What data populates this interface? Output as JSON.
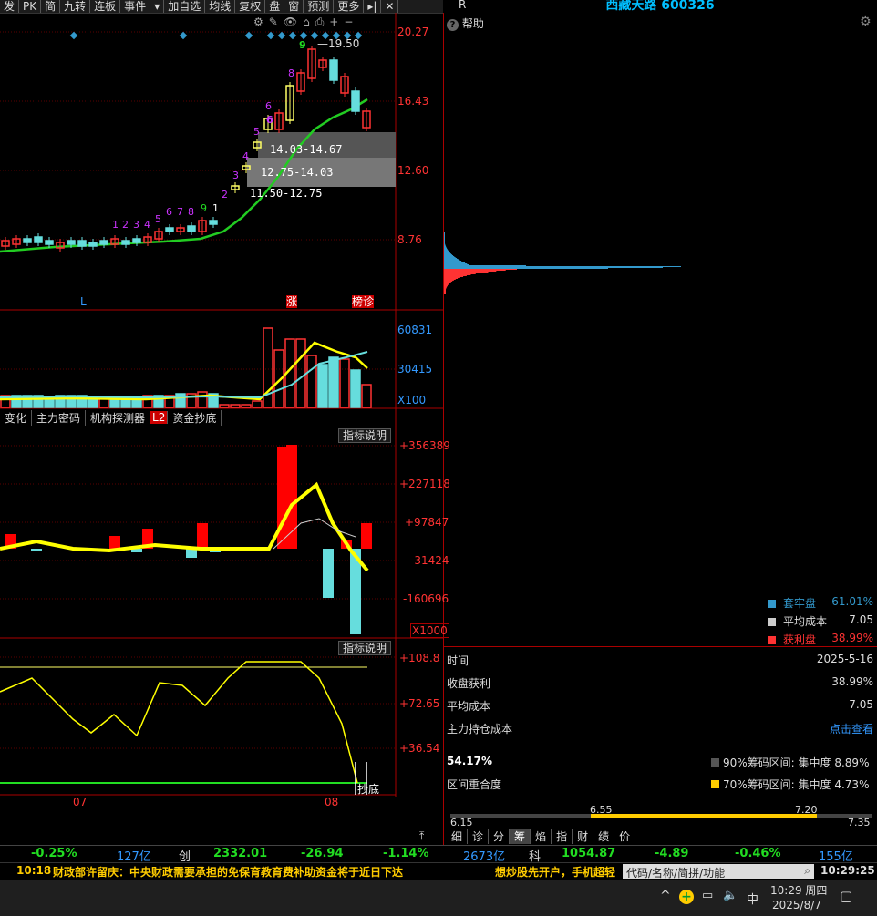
{
  "toolbar": {
    "items": [
      "发",
      "PK",
      "简",
      "九转",
      "连板",
      "事件",
      "▾",
      "加自选",
      "均线",
      "复权",
      "盘",
      "窗",
      "预测",
      "更多",
      "▸|",
      "✕"
    ]
  },
  "stock": {
    "title": "西藏天路 600326",
    "r_mark": "R"
  },
  "help": {
    "label": "帮助",
    "icon": "?"
  },
  "kline": {
    "price_axis": [
      "20.27",
      "16.43",
      "12.60",
      "8.76"
    ],
    "high_label": "19.50",
    "zones": [
      "14.03-14.67",
      "12.75-14.03",
      "11.50-12.75"
    ],
    "seq_top": [
      "1",
      "2",
      "3",
      "4",
      "5",
      "6",
      "7",
      "8",
      "9"
    ],
    "seq_mid": [
      "1",
      "2",
      "3",
      "4",
      "5",
      "6",
      "7",
      "8",
      "9",
      "1",
      "2",
      "3",
      "4",
      "5",
      "6",
      "8"
    ],
    "markers": {
      "l": "L",
      "zhang": "涨",
      "bangzhen": "榜诊"
    },
    "tool_icons": [
      "⚙",
      "✎",
      "👁",
      "⌂",
      "⎙",
      "+",
      "−"
    ]
  },
  "volume": {
    "axis": [
      "60831",
      "30415",
      "X100"
    ]
  },
  "tabs": {
    "items": [
      "变化",
      "主力密码",
      "机构探测器",
      "L2",
      "资金抄底"
    ]
  },
  "ind1": {
    "btn": "指标说明",
    "axis": [
      "+356389",
      "+227118",
      "+97847",
      "-31424",
      "-160696",
      "X1000"
    ]
  },
  "ind2": {
    "btn": "指标说明",
    "axis": [
      "+108.8",
      "+72.65",
      "+36.54"
    ],
    "bottom_label": "抄底"
  },
  "xaxis": {
    "labels": [
      "07",
      "08"
    ]
  },
  "chip": {
    "legend": [
      {
        "name": "套牢盘",
        "value": "61.01%",
        "color": "#3399cc"
      },
      {
        "name": "平均成本",
        "value": "7.05",
        "color": "#cccccc"
      },
      {
        "name": "获利盘",
        "value": "38.99%",
        "color": "#ff3333"
      }
    ],
    "rows": [
      {
        "label": "时间",
        "value": "2025-5-16"
      },
      {
        "label": "收盘获利",
        "value": "38.99%"
      },
      {
        "label": "平均成本",
        "value": "7.05"
      },
      {
        "label": "主力持仓成本",
        "value": "点击查看"
      }
    ],
    "overlap_pct": "54.17%",
    "overlap_label": "区间重合度",
    "range90": "90%筹码区间: 集中度 8.89%",
    "range70": "70%筹码区间: 集中度 4.73%",
    "scale": [
      "6.15",
      "6.55",
      "7.20",
      "7.35"
    ],
    "bottom_tabs": [
      "细",
      "诊",
      "分",
      "筹",
      "焰",
      "指",
      "财",
      "绩",
      "价"
    ],
    "active_tab": "筹"
  },
  "indexbar": {
    "items": [
      "-0.25%",
      "127亿",
      "创",
      "2332.01",
      "-26.94",
      "-1.14%",
      "2673亿",
      "科",
      "1054.87",
      "-4.89",
      "-0.46%",
      "155亿"
    ]
  },
  "news": {
    "time": "10:18",
    "text": "财政部许留庆：中央财政需要承担的免保育教育费补助资金将于近日下达",
    "ad": "想炒股先开户，手机超轻",
    "search_placeholder": "代码/名称/简拼/功能",
    "clock": "10:29:25"
  },
  "taskbar": {
    "ime": "中",
    "time": "10:29 周四",
    "date": "2025/8/7"
  }
}
